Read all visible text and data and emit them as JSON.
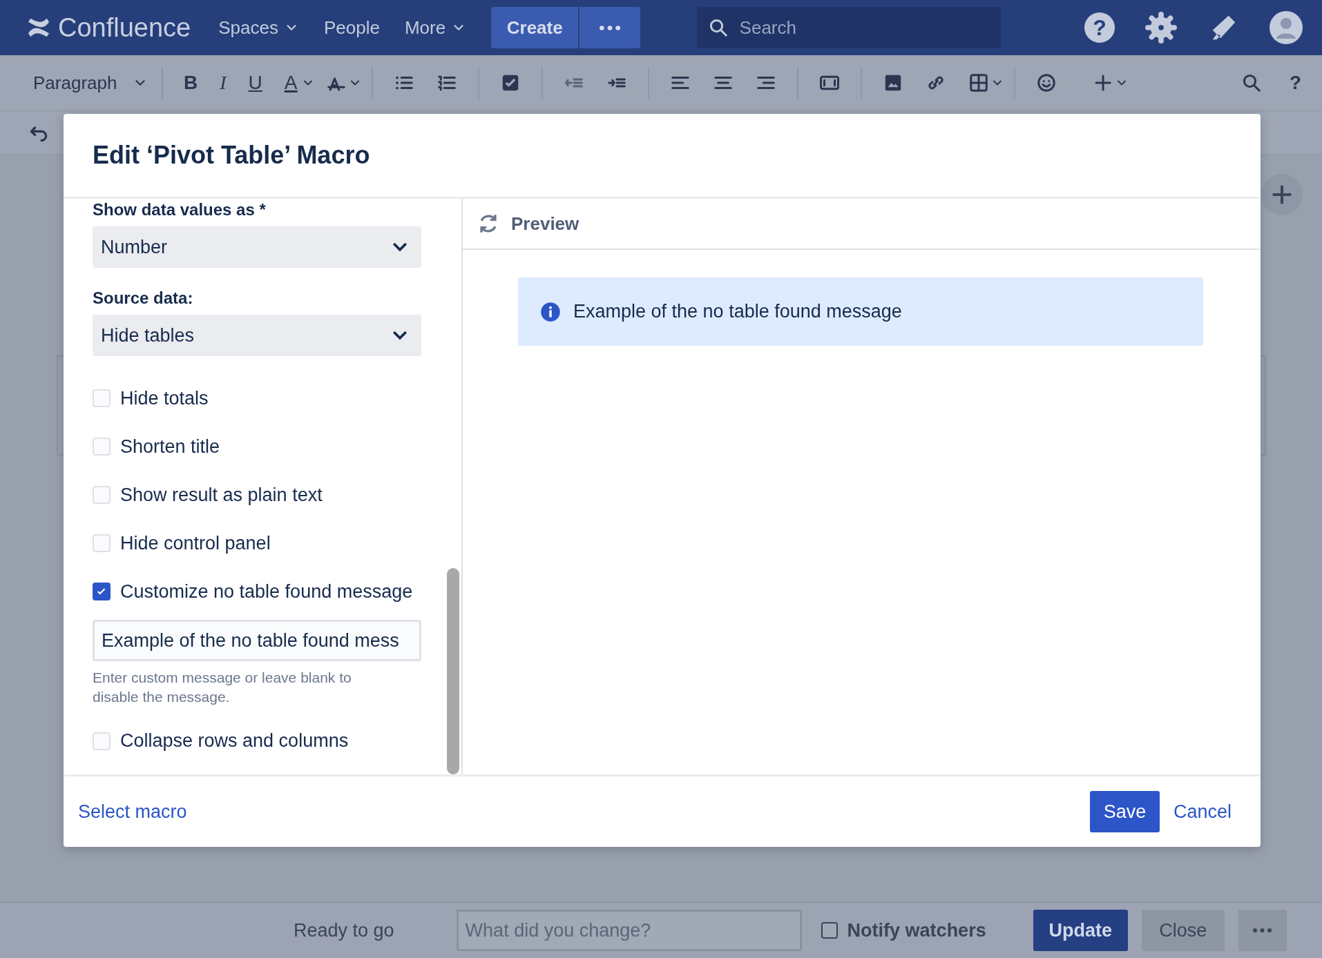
{
  "nav": {
    "logo": "Confluence",
    "menus": [
      {
        "label": "Spaces",
        "dropdown": true
      },
      {
        "label": "People",
        "dropdown": false
      },
      {
        "label": "More",
        "dropdown": true
      }
    ],
    "create": "Create",
    "search": {
      "placeholder": "Search"
    },
    "help": "?"
  },
  "toolbar": {
    "style": "Paragraph",
    "format_keys": [
      "B",
      "I",
      "U",
      "A"
    ],
    "help": "?"
  },
  "dialog": {
    "title": "Edit ‘Pivot Table’ Macro",
    "fields": [
      {
        "kind": "select",
        "label": "Show data values as *",
        "value": "Number"
      },
      {
        "kind": "select",
        "label": "Source data:",
        "value": "Hide tables"
      },
      {
        "kind": "checkbox",
        "label": "Hide totals",
        "checked": false
      },
      {
        "kind": "checkbox",
        "label": "Shorten title",
        "checked": false
      },
      {
        "kind": "checkbox",
        "label": "Show result as plain text",
        "checked": false
      },
      {
        "kind": "checkbox",
        "label": "Hide control panel",
        "checked": false
      },
      {
        "kind": "checkbox",
        "label": "Customize no table found message",
        "checked": true
      },
      {
        "kind": "text",
        "value": "Example of the no table found mess",
        "help": "Enter custom message or leave blank to disable the message."
      },
      {
        "kind": "checkbox",
        "label": "Collapse rows and columns",
        "checked": false
      }
    ],
    "preview": {
      "title": "Preview",
      "message": "Example of the no table found message"
    },
    "footer": {
      "link": "Select macro",
      "save": "Save",
      "cancel": "Cancel"
    }
  },
  "status_bar": {
    "status": "Ready to go",
    "comment": {
      "placeholder": "What did you change?"
    },
    "notify": {
      "label": "Notify watchers",
      "checked": false
    },
    "update": "Update",
    "close": "Close"
  }
}
